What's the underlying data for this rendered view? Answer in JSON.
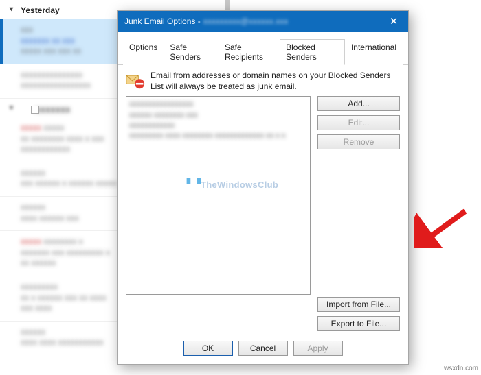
{
  "mail_list": {
    "day_header": "Yesterday"
  },
  "dialog": {
    "title": "Junk Email Options - ",
    "close_glyph": "✕",
    "tabs": {
      "options": "Options",
      "safe_senders": "Safe Senders",
      "safe_recipients": "Safe Recipients",
      "blocked_senders": "Blocked Senders",
      "international": "International"
    },
    "description": "Email from addresses or domain names on your Blocked Senders List will always be treated as junk email.",
    "buttons": {
      "add": "Add...",
      "edit": "Edit...",
      "remove": "Remove",
      "import": "Import from File...",
      "export": "Export to File..."
    },
    "footer": {
      "ok": "OK",
      "cancel": "Cancel",
      "apply": "Apply"
    }
  },
  "watermark": "TheWindowsClub",
  "source": "wsxdn.com"
}
